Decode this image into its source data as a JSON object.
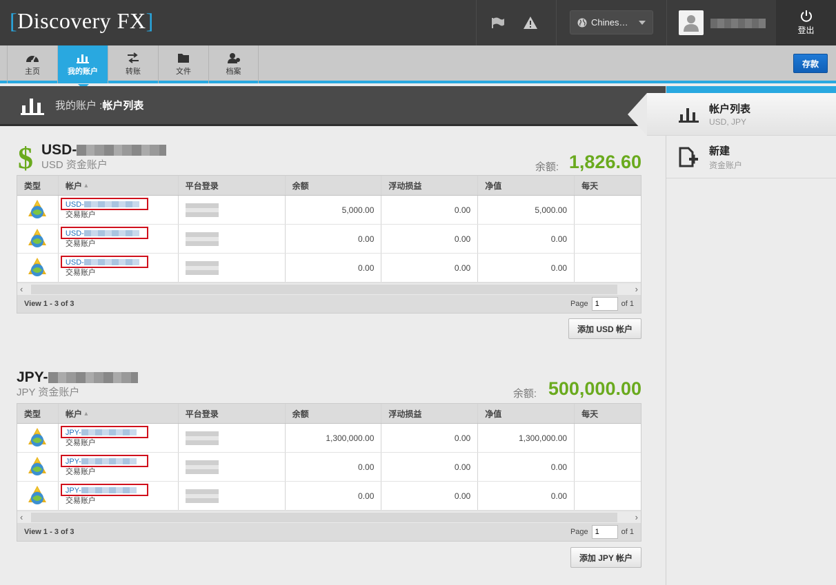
{
  "header": {
    "logo_left": "[",
    "logo_text": "Discovery FX",
    "logo_right": "]",
    "language": "Chines…",
    "logout": "登出"
  },
  "nav": {
    "items": [
      {
        "label": "主页",
        "icon": "dashboard-icon"
      },
      {
        "label": "我的账户",
        "icon": "bar-chart-icon"
      },
      {
        "label": "转账",
        "icon": "transfer-icon"
      },
      {
        "label": "文件",
        "icon": "folder-icon"
      },
      {
        "label": "档案",
        "icon": "profile-icon"
      }
    ],
    "deposit": "存款"
  },
  "title": {
    "section": "我的账户 : ",
    "page": "帐户列表"
  },
  "columns": [
    "类型",
    "帐户",
    "平台登录",
    "余额",
    "浮动损益",
    "净值",
    "每天"
  ],
  "sort_indicator": "▴",
  "usd": {
    "currency_symbol": "$",
    "name": "USD-",
    "subtitle": "USD 资金账户",
    "balance_label": "余额:",
    "balance": "1,826.60",
    "rows": [
      {
        "account": "USD-",
        "type": "交易账户",
        "balance": "5,000.00",
        "pnl": "0.00",
        "equity": "5,000.00"
      },
      {
        "account": "USD-",
        "type": "交易账户",
        "balance": "0.00",
        "pnl": "0.00",
        "equity": "0.00"
      },
      {
        "account": "USD-",
        "type": "交易账户",
        "balance": "0.00",
        "pnl": "0.00",
        "equity": "0.00"
      }
    ],
    "view": "View 1 - 3 of 3",
    "page_label": "Page",
    "page_value": "1",
    "of_label": "of 1",
    "add_button": "添加 USD 帐户"
  },
  "jpy": {
    "name": "JPY-",
    "subtitle": "JPY 资金账户",
    "balance_label": "余额:",
    "balance": "500,000.00",
    "rows": [
      {
        "account": "JPY-",
        "type": "交易账户",
        "balance": "1,300,000.00",
        "pnl": "0.00",
        "equity": "1,300,000.00"
      },
      {
        "account": "JPY-",
        "type": "交易账户",
        "balance": "0.00",
        "pnl": "0.00",
        "equity": "0.00"
      },
      {
        "account": "JPY-",
        "type": "交易账户",
        "balance": "0.00",
        "pnl": "0.00",
        "equity": "0.00"
      }
    ],
    "view": "View 1 - 3 of 3",
    "page_label": "Page",
    "page_value": "1",
    "of_label": "of 1",
    "add_button": "添加 JPY 帐户"
  },
  "sidebar": {
    "items": [
      {
        "title": "帐户列表",
        "subtitle": "USD, JPY"
      },
      {
        "title": "新建",
        "subtitle": "资金账户"
      }
    ]
  },
  "colors": {
    "accent": "#29a8e0",
    "balance_green": "#6aaa1e",
    "highlight_red": "#d0101c"
  }
}
